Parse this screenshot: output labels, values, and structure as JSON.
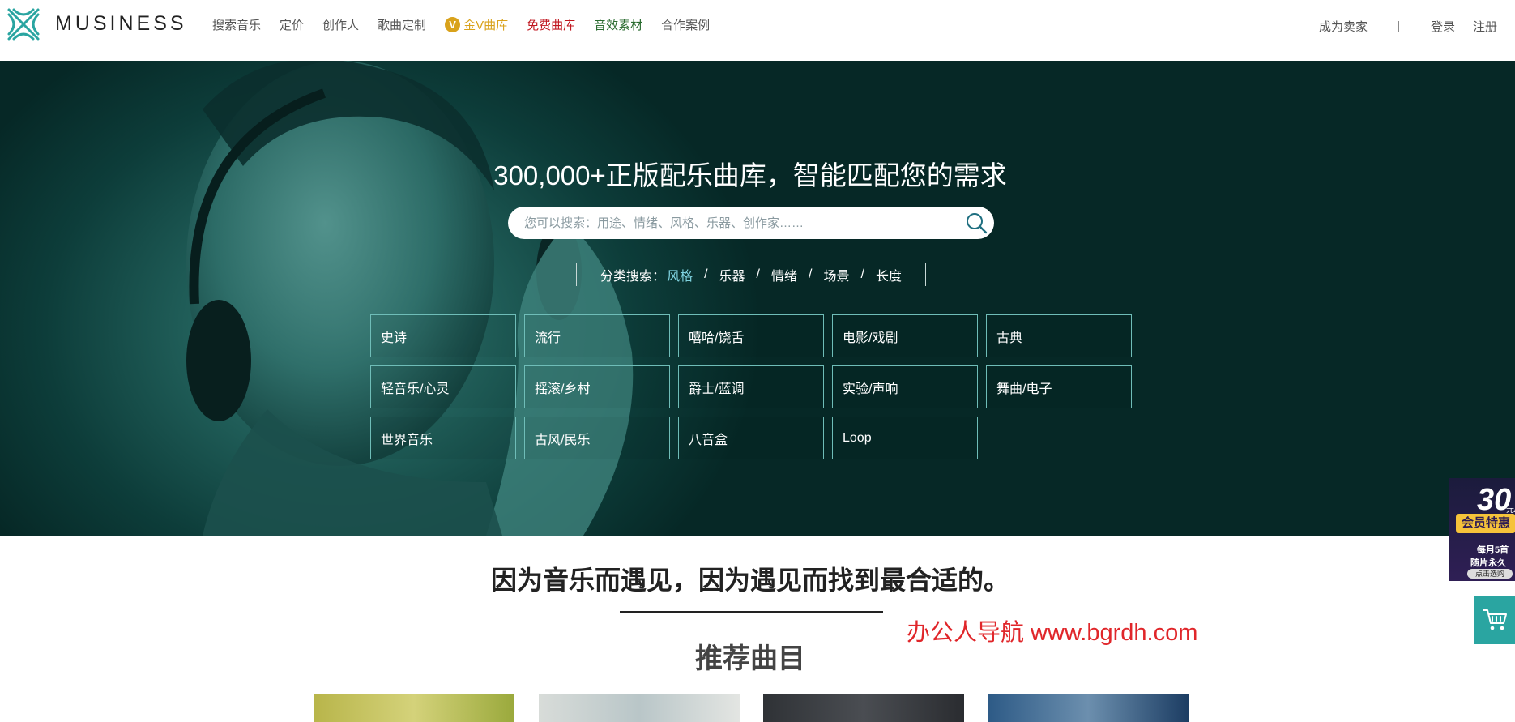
{
  "header": {
    "logo_text": "MUSINESS",
    "nav": [
      {
        "label": "搜索音乐"
      },
      {
        "label": "定价"
      },
      {
        "label": "创作人"
      },
      {
        "label": "歌曲定制"
      },
      {
        "label": "金V曲库",
        "badge": "V"
      },
      {
        "label": "免费曲库"
      },
      {
        "label": "音效素材"
      },
      {
        "label": "合作案例"
      }
    ],
    "become_seller": "成为卖家",
    "separator": "|",
    "login": "登录",
    "register": "注册"
  },
  "hero": {
    "title": "300,000+正版配乐曲库，智能匹配您的需求",
    "search_placeholder": "您可以搜索：用途、情绪、风格、乐器、创作家……",
    "category_label": "分类搜索：",
    "category_tabs": [
      "风格",
      "乐器",
      "情绪",
      "场景",
      "长度"
    ],
    "active_tab": "风格",
    "genres": [
      "史诗",
      "流行",
      "嘻哈/饶舌",
      "电影/戏剧",
      "古典",
      "轻音乐/心灵",
      "摇滚/乡村",
      "爵士/蓝调",
      "实验/声响",
      "舞曲/电子",
      "世界音乐",
      "古风/民乐",
      "八音盒",
      "Loop"
    ]
  },
  "main": {
    "tagline": "因为音乐而遇见，因为遇见而找到最合适的。",
    "recommend_title": "推荐曲目",
    "watermark": "办公人导航 www.bgrdh.com"
  },
  "promo": {
    "price": "30",
    "unit": "元/月",
    "badge": "会员特惠",
    "line1": "每月5首",
    "line2": "随片永久",
    "cta": "点击选购"
  },
  "colors": {
    "accent": "#2aa5a1",
    "gold": "#d9a21b",
    "free_red": "#c0161f",
    "sfx_green": "#2a6b2f",
    "hero_dark": "#0d3d3a",
    "active_tab": "#7fd3e0"
  }
}
